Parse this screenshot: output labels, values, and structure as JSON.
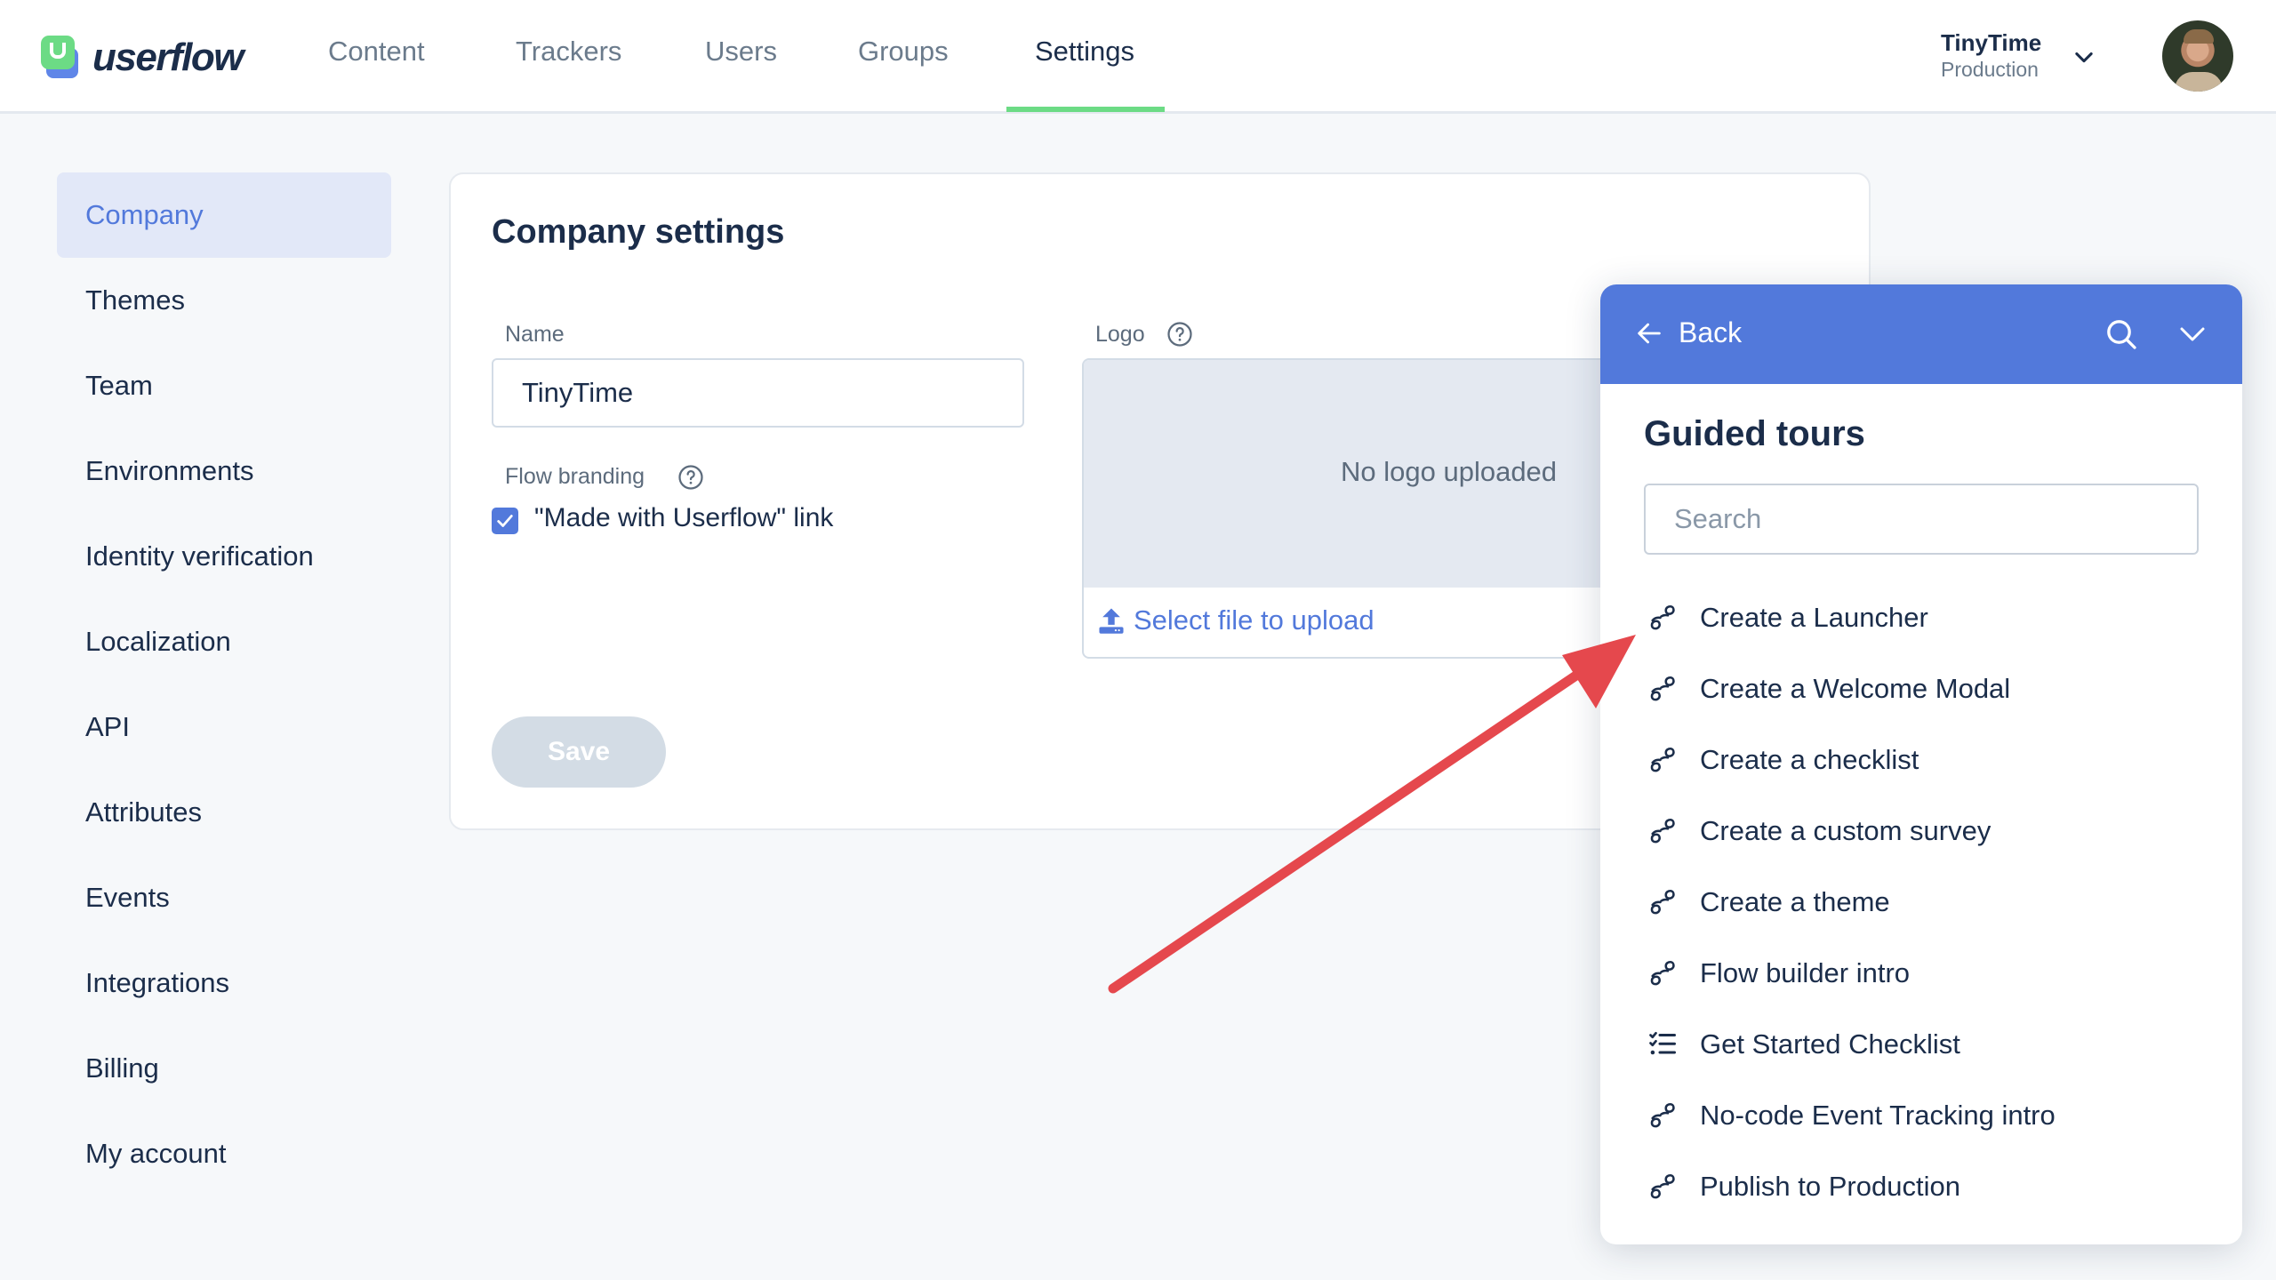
{
  "brand": {
    "name": "userflow",
    "colors": {
      "accent": "#5279DB",
      "green": "#6CDB85",
      "text": "#1B2D4A",
      "muted": "#6B7B8C",
      "annotation": "#E5484D"
    }
  },
  "nav": {
    "items": [
      {
        "label": "Content",
        "active": false
      },
      {
        "label": "Trackers",
        "active": false
      },
      {
        "label": "Users",
        "active": false
      },
      {
        "label": "Groups",
        "active": false
      },
      {
        "label": "Settings",
        "active": true
      }
    ]
  },
  "org_switcher": {
    "name": "TinyTime",
    "environment": "Production",
    "icon": "chevron-down-icon"
  },
  "user": {
    "avatar": "user-avatar"
  },
  "sidebar": {
    "items": [
      {
        "label": "Company",
        "active": true
      },
      {
        "label": "Themes"
      },
      {
        "label": "Team"
      },
      {
        "label": "Environments"
      },
      {
        "label": "Identity verification"
      },
      {
        "label": "Localization"
      },
      {
        "label": "API"
      },
      {
        "label": "Attributes"
      },
      {
        "label": "Events"
      },
      {
        "label": "Integrations"
      },
      {
        "label": "Billing"
      },
      {
        "label": "My account"
      }
    ]
  },
  "company_settings": {
    "title": "Company settings",
    "name_label": "Name",
    "name_value": "TinyTime",
    "flow_branding_label": "Flow branding",
    "made_with_label": "\"Made with Userflow\" link",
    "made_with_checked": true,
    "logo_label": "Logo",
    "no_logo_text": "No logo uploaded",
    "upload_label": "Select file to upload",
    "save_label": "Save"
  },
  "guided_tours_panel": {
    "back_label": "Back",
    "title": "Guided tours",
    "search_placeholder": "Search",
    "items": [
      {
        "label": "Create a Launcher",
        "icon": "footprints-icon"
      },
      {
        "label": "Create a Welcome Modal",
        "icon": "footprints-icon"
      },
      {
        "label": "Create a checklist",
        "icon": "footprints-icon"
      },
      {
        "label": "Create a custom survey",
        "icon": "footprints-icon"
      },
      {
        "label": "Create a theme",
        "icon": "footprints-icon"
      },
      {
        "label": "Flow builder intro",
        "icon": "footprints-icon"
      },
      {
        "label": "Get Started Checklist",
        "icon": "checklist-icon"
      },
      {
        "label": "No-code Event Tracking intro",
        "icon": "footprints-icon"
      },
      {
        "label": "Publish to Production",
        "icon": "footprints-icon"
      }
    ]
  },
  "annotation": {
    "type": "arrow",
    "color": "#E5484D",
    "points_to": "Create a Launcher"
  }
}
